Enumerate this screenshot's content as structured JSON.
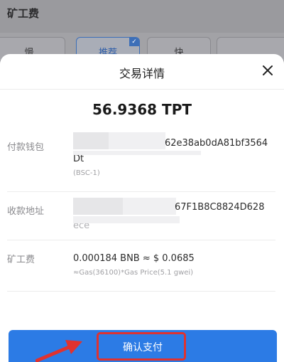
{
  "background": {
    "title": "矿工费",
    "options": [
      "慢",
      "推荐",
      "快"
    ]
  },
  "dialog": {
    "title": "交易详情",
    "amount": "56.9368 TPT",
    "rows": [
      {
        "label": "付款钱包",
        "value_tail": "62e38ab0dA81bf3564",
        "value_line2": "Dt",
        "sub": "(BSC-1)"
      },
      {
        "label": "收款地址",
        "value_tail": "67F1B8C8824D628",
        "value_line2": "ece"
      },
      {
        "label": "矿工费",
        "value": "0.000184 BNB ≈ $ 0.0685",
        "sub": "≈Gas(36100)*Gas Price(5.1 gwei)"
      }
    ],
    "confirm_label": "确认支付"
  },
  "colors": {
    "accent": "#2c7be5",
    "highlight": "#e0322f"
  }
}
